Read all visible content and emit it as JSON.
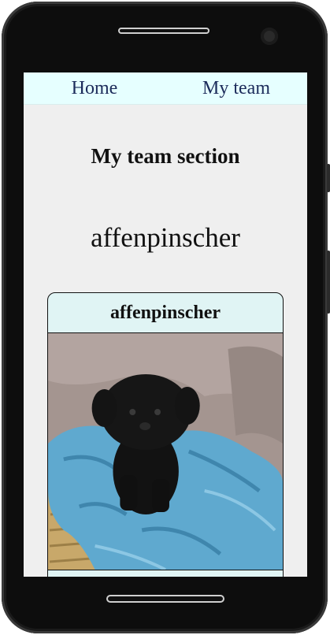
{
  "nav": {
    "home_label": "Home",
    "my_team_label": "My team"
  },
  "page": {
    "section_title": "My team section",
    "breed_heading": "affenpinscher"
  },
  "card": {
    "title": "affenpinscher",
    "photo_subject": "black affenpinscher puppy on blue blanket in wicker basket"
  },
  "colors": {
    "nav_background": "#e6ffff",
    "nav_link": "#1b2b5a",
    "page_background": "#efefef",
    "card_background": "#e0f4f4"
  }
}
